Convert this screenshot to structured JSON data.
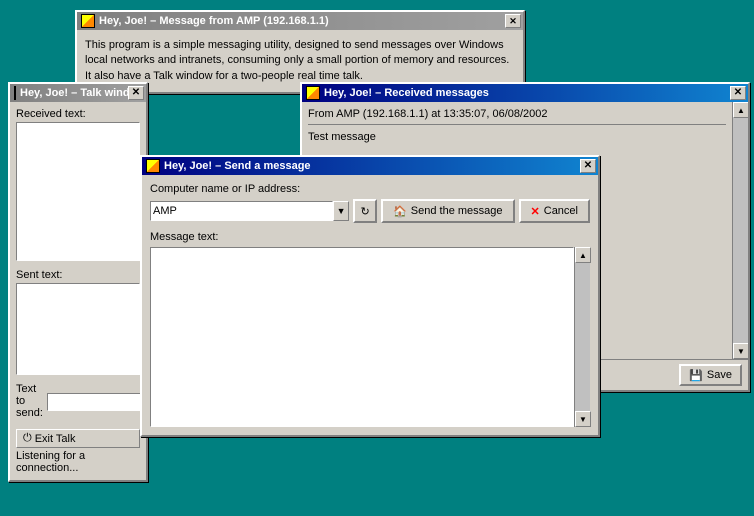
{
  "windows": {
    "message_from": {
      "title": "Hey, Joe! – Message from AMP (192.168.1.1)",
      "body": "This program is a simple messaging utility, designed to send messages over Windows local networks and intranets, consuming only a small portion of memory and resources. It also have a Talk window for a two-people real time talk."
    },
    "talk": {
      "title": "Hey, Joe! – Talk window",
      "received_label": "Received text:",
      "sent_label": "Sent text:",
      "text_to_send_label": "Text to send:",
      "status": "Listening for a connection...",
      "exit_talk_label": "Exit Talk"
    },
    "received": {
      "title": "Hey, Joe! – Received messages",
      "from_line": "From AMP (192.168.1.1) at 13:35:07, 06/08/2002",
      "message": "Test message",
      "save_label": "Save"
    },
    "send": {
      "title": "Hey, Joe! – Send a message",
      "computer_label": "Computer name or IP address:",
      "computer_value": "AMP",
      "message_label": "Message text:",
      "send_label": "Send the message",
      "cancel_label": "Cancel"
    }
  },
  "icons": {
    "close": "✕",
    "minimize": "─",
    "dropdown_arrow": "▼",
    "scroll_up": "▲",
    "scroll_down": "▼",
    "send_icon": "🏠",
    "cancel_x": "✕",
    "save_icon": "💾",
    "exit_icon": "⏻",
    "refresh": "↻"
  }
}
